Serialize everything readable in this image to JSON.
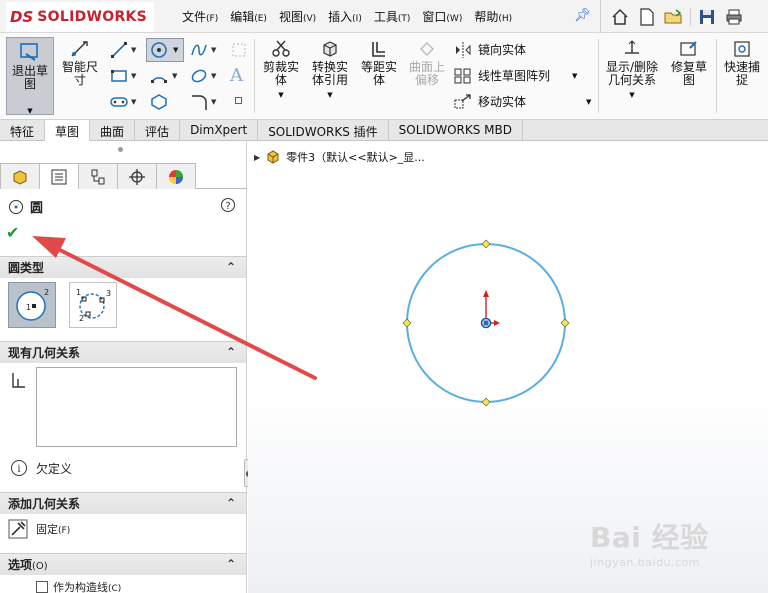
{
  "app": {
    "logo_ds": "DS",
    "logo_name": "SOLIDWORKS"
  },
  "menu": [
    {
      "label": "文件",
      "key": "(F)"
    },
    {
      "label": "编辑",
      "key": "(E)"
    },
    {
      "label": "视图",
      "key": "(V)"
    },
    {
      "label": "插入",
      "key": "(I)"
    },
    {
      "label": "工具",
      "key": "(T)"
    },
    {
      "label": "窗口",
      "key": "(W)"
    },
    {
      "label": "帮助",
      "key": "(H)"
    }
  ],
  "ribbon": {
    "exit_sketch": "退出草图",
    "smart_dimension_1": "智能尺",
    "smart_dimension_2": "寸",
    "trim_1": "剪裁实",
    "trim_2": "体",
    "convert_1": "转换实",
    "convert_2": "体引用",
    "offset_1": "等距实",
    "offset_2": "体",
    "surface_offset_1": "曲面上",
    "surface_offset_2": "偏移",
    "mirror": "镜向实体",
    "linear_pattern": "线性草图阵列",
    "move": "移动实体",
    "show_delete_1": "显示/删除",
    "show_delete_2": "几何关系",
    "repair_1": "修复草",
    "repair_2": "图",
    "quick_snap_1": "快速捕",
    "quick_snap_2": "捉"
  },
  "tabs": [
    "特征",
    "草图",
    "曲面",
    "评估",
    "DimXpert",
    "SOLIDWORKS 插件",
    "SOLIDWORKS MBD"
  ],
  "active_tab": "草图",
  "panel": {
    "title": "圆",
    "circle_type": {
      "heading": "圆类型",
      "option1_labels": [
        "1",
        "2"
      ],
      "option2_labels": [
        "1",
        "2",
        "3"
      ]
    },
    "existing_relations": {
      "heading": "现有几何关系"
    },
    "status": "欠定义",
    "add_relations": {
      "heading": "添加几何关系",
      "fix_label": "固定",
      "fix_key": "(F)"
    },
    "options": {
      "heading": "选项",
      "heading_key": "(O)",
      "construction_label": "作为构造线",
      "construction_key": "(C)"
    }
  },
  "viewport": {
    "tree_item": "零件3（默认<<默认>_显...",
    "circle_color": "#5aaee0",
    "handle_color": "#f6e64a"
  },
  "annotation": {
    "arrow_color": "#e04a4a"
  },
  "watermark": {
    "top": "Bai 经验",
    "bottom": "jingyan.baidu.com"
  }
}
